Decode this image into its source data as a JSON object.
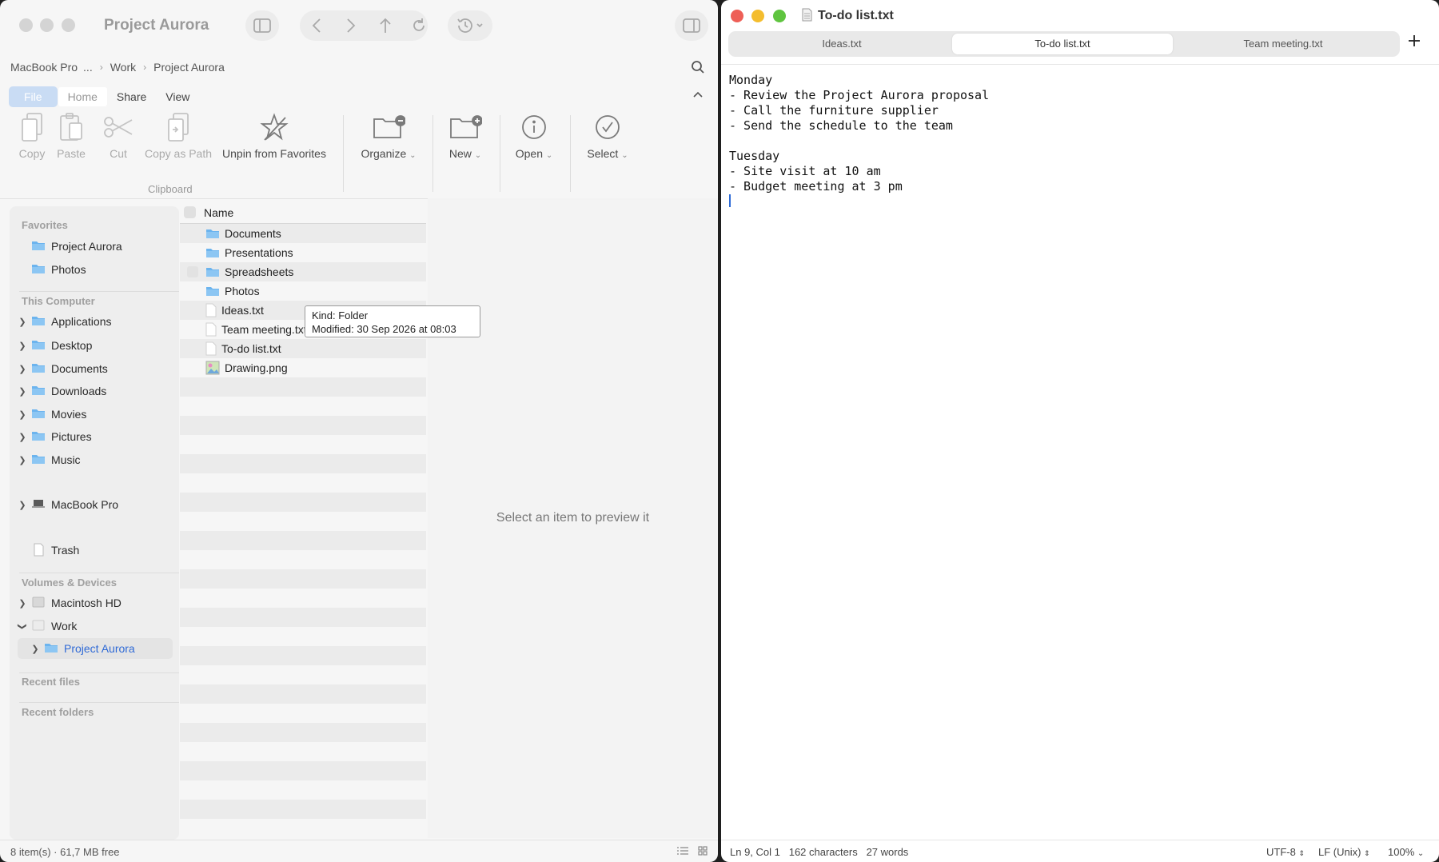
{
  "finder": {
    "title": "Project Aurora",
    "breadcrumb": [
      "MacBook Pro",
      "...",
      "Work",
      "Project Aurora"
    ],
    "ribbon_tabs": [
      "File",
      "Home",
      "Share",
      "View"
    ],
    "ribbon": {
      "copy": "Copy",
      "paste": "Paste",
      "cut": "Cut",
      "copy_as_path": "Copy as Path",
      "unpin": "Unpin from Favorites",
      "organize": "Organize",
      "new": "New",
      "open": "Open",
      "select": "Select",
      "group_clipboard": "Clipboard"
    },
    "sidebar": {
      "favorites_header": "Favorites",
      "favorites": [
        "Project Aurora",
        "Photos"
      ],
      "this_computer_header": "This Computer",
      "this_computer": [
        "Applications",
        "Desktop",
        "Documents",
        "Downloads",
        "Movies",
        "Pictures",
        "Music"
      ],
      "macbook": "MacBook Pro",
      "trash": "Trash",
      "volumes_header": "Volumes & Devices",
      "volumes": [
        "Macintosh HD",
        "Work",
        "Project Aurora"
      ],
      "recent_files": "Recent files",
      "recent_folders": "Recent folders"
    },
    "list_header": "Name",
    "files": [
      {
        "name": "Documents",
        "kind": "folder"
      },
      {
        "name": "Presentations",
        "kind": "folder"
      },
      {
        "name": "Spreadsheets",
        "kind": "folder"
      },
      {
        "name": "Photos",
        "kind": "folder"
      },
      {
        "name": "Ideas.txt",
        "kind": "text"
      },
      {
        "name": "Team meeting.txt",
        "kind": "text"
      },
      {
        "name": "To-do list.txt",
        "kind": "text"
      },
      {
        "name": "Drawing.png",
        "kind": "image"
      }
    ],
    "tooltip": {
      "kind": "Kind: Folder",
      "modified": "Modified: 30 Sep 2026 at 08:03"
    },
    "preview_text": "Select an item to preview it",
    "status": "8 item(s)  ·  61,7 MB free"
  },
  "editor": {
    "title": "To-do list.txt",
    "tabs": [
      "Ideas.txt",
      "To-do list.txt",
      "Team meeting.txt"
    ],
    "active_tab": 1,
    "content": "Monday\n- Review the Project Aurora proposal\n- Call the furniture supplier\n- Send the schedule to the team\n\nTuesday\n- Site visit at 10 am\n- Budget meeting at 3 pm\n",
    "status": {
      "position": "Ln 9, Col 1",
      "characters": "162 characters",
      "words": "27 words",
      "encoding": "UTF-8",
      "line_endings": "LF (Unix)",
      "zoom": "100%"
    }
  },
  "colors": {
    "close": "#ee5f57",
    "minimize": "#f4bd2e",
    "zoom": "#5fc43f",
    "accent": "#2f6ad6",
    "folder": "#6cb4ee"
  }
}
